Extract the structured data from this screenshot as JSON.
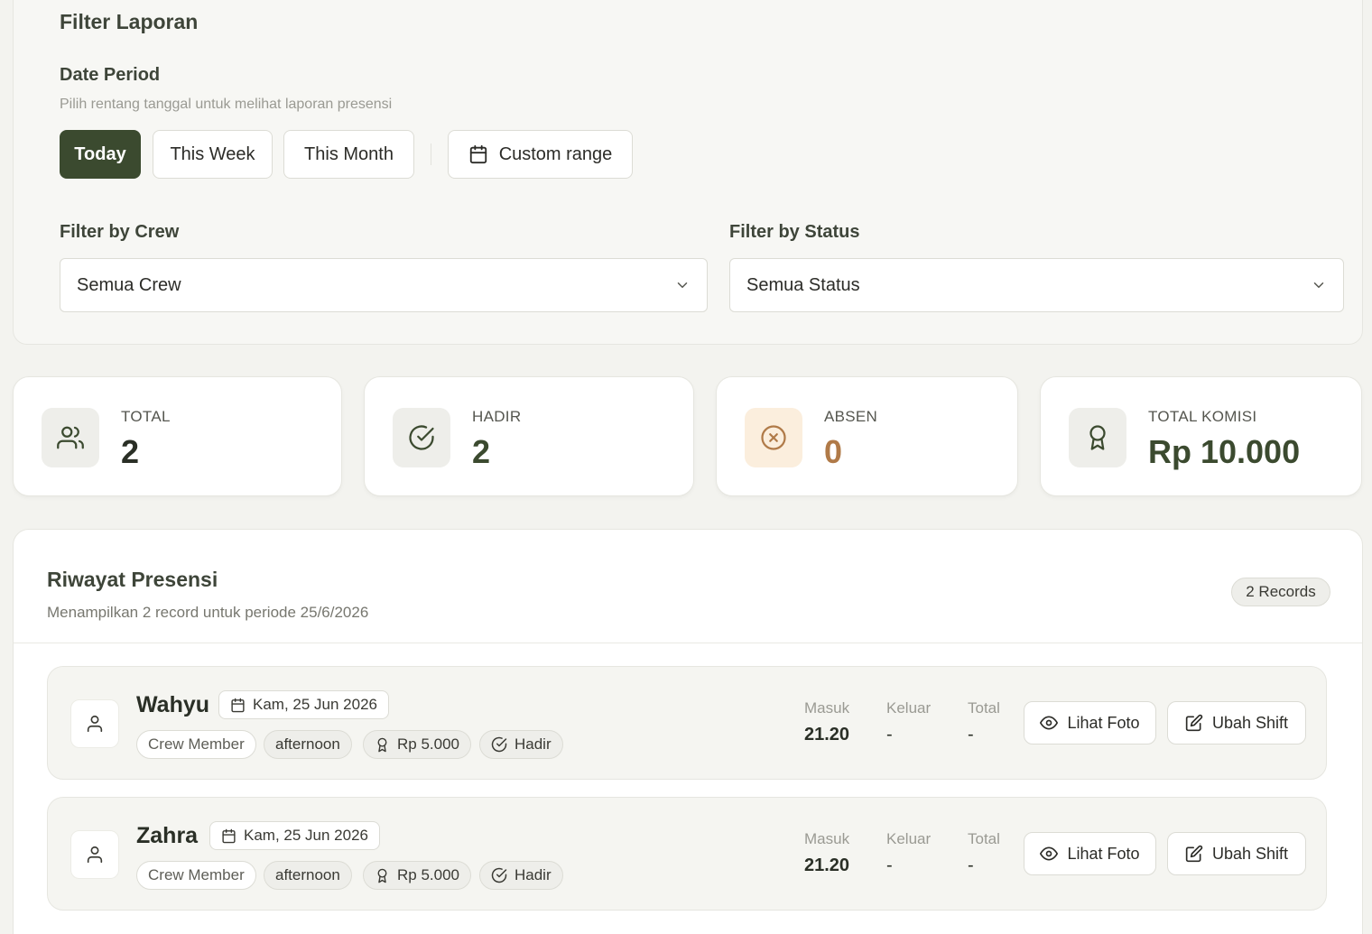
{
  "filter": {
    "title": "Filter Laporan",
    "period_title": "Date Period",
    "period_subtitle": "Pilih rentang tanggal untuk melihat laporan presensi",
    "period_buttons": {
      "today": "Today",
      "this_week": "This Week",
      "this_month": "This Month",
      "custom_range": "Custom range"
    },
    "active_period": "Today",
    "crew_label": "Filter by Crew",
    "crew_value": "Semua Crew",
    "status_label": "Filter by Status",
    "status_value": "Semua Status"
  },
  "stats": {
    "total": {
      "label": "TOTAL",
      "value": "2",
      "icon": "users-icon"
    },
    "hadir": {
      "label": "HADIR",
      "value": "2",
      "icon": "check-circle-icon"
    },
    "absen": {
      "label": "ABSEN",
      "value": "0",
      "icon": "x-circle-icon"
    },
    "komisi": {
      "label": "TOTAL KOMISI",
      "value": "Rp 10.000",
      "icon": "award-icon"
    }
  },
  "history": {
    "title": "Riwayat Presensi",
    "subtitle": "Menampilkan 2 record untuk periode 25/6/2026",
    "records_badge": "2 Records",
    "column_labels": {
      "masuk": "Masuk",
      "keluar": "Keluar",
      "total": "Total"
    },
    "action_labels": {
      "view_photo": "Lihat Foto",
      "edit_shift": "Ubah Shift"
    },
    "records": [
      {
        "name": "Wahyu",
        "date": "Kam, 25 Jun 2026",
        "role": "Crew Member",
        "shift": "afternoon",
        "commission": "Rp 5.000",
        "status": "Hadir",
        "masuk": "21.20",
        "keluar": "-",
        "total": "-"
      },
      {
        "name": "Zahra",
        "date": "Kam, 25 Jun 2026",
        "role": "Crew Member",
        "shift": "afternoon",
        "commission": "Rp 5.000",
        "status": "Hadir",
        "masuk": "21.20",
        "keluar": "-",
        "total": "-"
      }
    ]
  },
  "colors": {
    "primary": "#3b4a2f",
    "warning": "#b07a48",
    "warning_bg": "#fbeedd",
    "background": "#f3f3ef"
  }
}
